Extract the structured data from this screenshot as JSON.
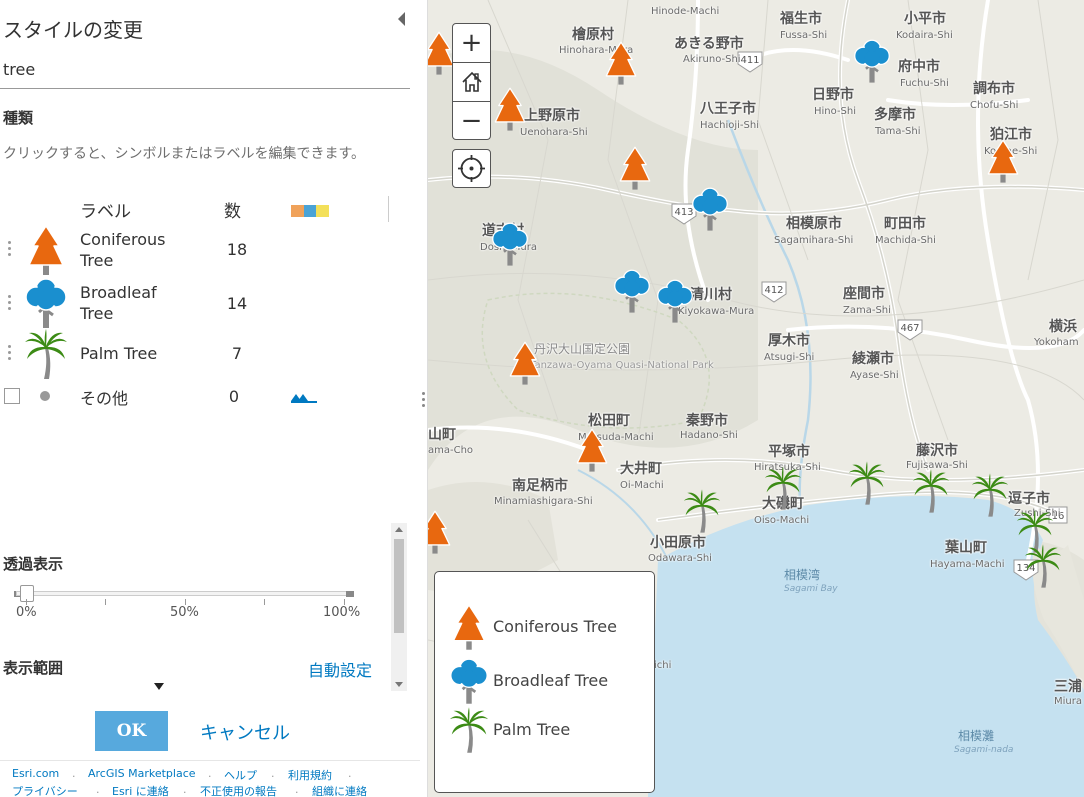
{
  "style_panel": {
    "title": "スタイルの変更",
    "layer_name": "tree",
    "types_heading": "種類",
    "instructions": "クリックすると、シンボルまたはラベルを編集できます。",
    "column_label": "ラベル",
    "column_count": "数",
    "swatch_colors": [
      "#f0a25a",
      "#4aa3d6",
      "#f3e05a"
    ],
    "categories": [
      {
        "label": "Coniferous Tree",
        "count": "18",
        "icon": "coniferous-tree-icon",
        "color": "#e8680f"
      },
      {
        "label": "Broadleaf Tree",
        "count": "14",
        "icon": "broadleaf-tree-icon",
        "color": "#1a8fcf"
      },
      {
        "label": "Palm Tree",
        "count": "7",
        "icon": "palm-tree-icon",
        "color": "#3c8b15"
      }
    ],
    "other": {
      "label": "その他",
      "count": "0",
      "icon": "gray-dot-icon"
    },
    "transparency": {
      "heading": "透過表示",
      "value_percent": 0,
      "ticks": [
        "0%",
        "50%",
        "100%"
      ]
    },
    "visible_range": {
      "heading": "表示範囲",
      "auto_label": "自動設定"
    },
    "ok_label": "OK",
    "cancel_label": "キャンセル",
    "accent_color": "#0079c1"
  },
  "footer": {
    "links_row1": [
      "Esri.com",
      "ArcGIS Marketplace",
      "ヘルプ",
      "利用規約"
    ],
    "links_row2": [
      "プライバシー",
      "Esri に連絡",
      "不正使用の報告",
      "組織に連絡"
    ]
  },
  "map": {
    "controls": {
      "zoom_in": "+",
      "zoom_out": "−",
      "home_icon": "home-icon",
      "locate_icon": "locate-icon"
    },
    "place_labels": [
      {
        "name": "檜原村",
        "romaji": "Hinohara-Mura"
      },
      {
        "name": "あきる野市",
        "romaji": "Akiruno-Shi"
      },
      {
        "name": "福生市",
        "romaji": "Fussa-Shi"
      },
      {
        "name": "小平市",
        "romaji": "Kodaira-Shi"
      },
      {
        "name": "府中市",
        "romaji": "Fuchu-Shi"
      },
      {
        "name": "日野市",
        "romaji": "Hino-Shi"
      },
      {
        "name": "多摩市",
        "romaji": "Tama-Shi"
      },
      {
        "name": "調布市",
        "romaji": "Chofu-Shi"
      },
      {
        "name": "八王子市",
        "romaji": "Hachioji-Shi"
      },
      {
        "name": "上野原市",
        "romaji": "Uenohara-Shi"
      },
      {
        "name": "狛江市",
        "romaji": "Komae-Shi"
      },
      {
        "name": "相模原市",
        "romaji": "Sagamihara-Shi"
      },
      {
        "name": "町田市",
        "romaji": "Machida-Shi"
      },
      {
        "name": "座間市",
        "romaji": "Zama-Shi"
      },
      {
        "name": "清川村",
        "romaji": "Kiyokawa-Mura"
      },
      {
        "name": "厚木市",
        "romaji": "Atsugi-Shi"
      },
      {
        "name": "綾瀬市",
        "romaji": "Ayase-Shi"
      },
      {
        "name": "横浜",
        "romaji": "Yokoham"
      },
      {
        "name": "丹沢大山国定公園",
        "romaji": "Tanzawa-Oyama Quasi-National Park"
      },
      {
        "name": "松田町",
        "romaji": "Matsuda-Machi"
      },
      {
        "name": "秦野市",
        "romaji": "Hadano-Shi"
      },
      {
        "name": "平塚市",
        "romaji": "Hiratsuka-Shi"
      },
      {
        "name": "藤沢市",
        "romaji": "Fujisawa-Shi"
      },
      {
        "name": "南足柄市",
        "romaji": "Minamiashigara-Shi"
      },
      {
        "name": "大井町",
        "romaji": "Oi-Machi"
      },
      {
        "name": "大磯町",
        "romaji": "Oiso-Machi"
      },
      {
        "name": "逗子市",
        "romaji": "Zushi-Shi"
      },
      {
        "name": "小田原市",
        "romaji": "Odawara-Shi"
      },
      {
        "name": "葉山町",
        "romaji": "Hayama-Machi"
      },
      {
        "name": "三浦",
        "romaji": "Miura"
      },
      {
        "name": "山町",
        "romaji": "ama-Cho"
      },
      {
        "name": "道志村",
        "romaji": "Doshi-Mura"
      },
      {
        "name": "Hinode-Machi",
        "romaji": ""
      },
      {
        "name": "ichi",
        "romaji": ""
      }
    ],
    "water_labels": [
      {
        "name": "相模湾",
        "romaji": "Sagami Bay"
      },
      {
        "name": "相模灘",
        "romaji": "Sagami-nada"
      }
    ],
    "route_numbers": [
      "411",
      "413",
      "412",
      "467",
      "134",
      "16"
    ],
    "legend": [
      {
        "label": "Coniferous Tree",
        "icon": "coniferous-tree-icon"
      },
      {
        "label": "Broadleaf Tree",
        "icon": "broadleaf-tree-icon"
      },
      {
        "label": "Palm Tree",
        "icon": "palm-tree-icon"
      }
    ],
    "colors": {
      "land": "#ecebe4",
      "water": "#c5e1f0",
      "roads": "#ffffff",
      "coniferous": "#e8680f",
      "broadleaf": "#1a8fcf",
      "palm": "#3c8b15"
    }
  }
}
